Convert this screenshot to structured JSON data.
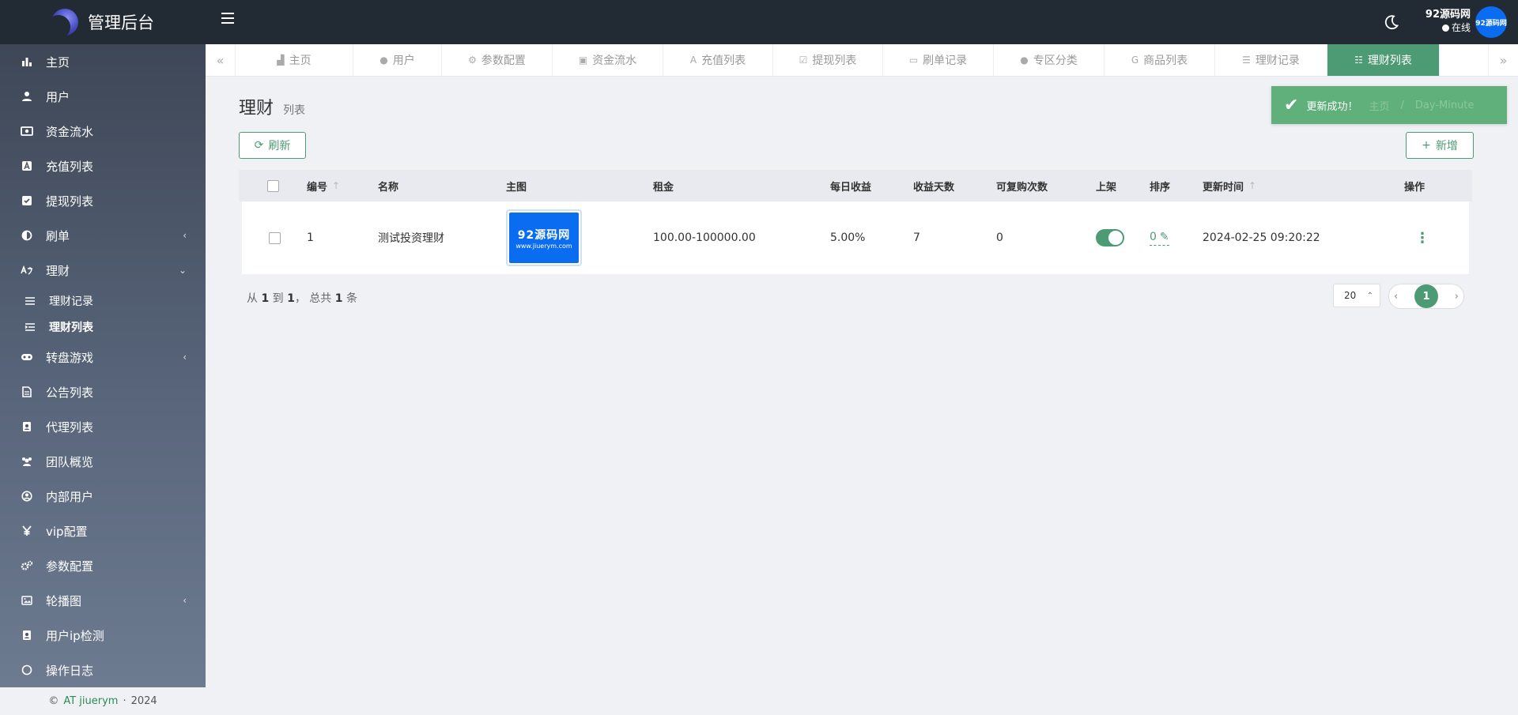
{
  "app": {
    "title": "管理后台"
  },
  "sidebar": {
    "items": [
      {
        "label": "主页",
        "icon": "bar-chart-icon"
      },
      {
        "label": "用户",
        "icon": "user-icon"
      },
      {
        "label": "资金流水",
        "icon": "money-icon"
      },
      {
        "label": "充值列表",
        "icon": "font-icon"
      },
      {
        "label": "提现列表",
        "icon": "check-square-icon"
      },
      {
        "label": "刷单",
        "icon": "adjust-icon",
        "expandable": true
      },
      {
        "label": "理财",
        "icon": "language-icon",
        "expanded": true
      },
      {
        "label": "理财记录",
        "icon": "list-icon",
        "sub": true
      },
      {
        "label": "理财列表",
        "icon": "indent-list-icon",
        "sub": true,
        "active": true
      },
      {
        "label": "转盘游戏",
        "icon": "gamepad-icon",
        "expandable": true
      },
      {
        "label": "公告列表",
        "icon": "file-icon"
      },
      {
        "label": "代理列表",
        "icon": "id-badge-icon"
      },
      {
        "label": "团队概览",
        "icon": "users-icon"
      },
      {
        "label": "内部用户",
        "icon": "user-circle-icon"
      },
      {
        "label": "vip配置",
        "icon": "yen-icon"
      },
      {
        "label": "参数配置",
        "icon": "cogs-icon"
      },
      {
        "label": "轮播图",
        "icon": "image-icon",
        "expandable": true
      },
      {
        "label": "用户ip检测",
        "icon": "id-card-icon"
      },
      {
        "label": "操作日志",
        "icon": "circle-icon"
      }
    ],
    "footer": {
      "copyright": "©",
      "link": "AT jiuerym",
      "sep": "·",
      "year": "2024"
    }
  },
  "topbar": {
    "user_name": "92源码网",
    "user_status": "在线",
    "avatar_text": "92源码网"
  },
  "tabs": [
    {
      "label": "主页",
      "icon": "▟"
    },
    {
      "label": "用户",
      "icon": "●"
    },
    {
      "label": "参数配置",
      "icon": "⚙"
    },
    {
      "label": "资金流水",
      "icon": "▣"
    },
    {
      "label": "充值列表",
      "icon": "A"
    },
    {
      "label": "提现列表",
      "icon": "☑"
    },
    {
      "label": "刷单记录",
      "icon": "▭"
    },
    {
      "label": "专区分类",
      "icon": "●"
    },
    {
      "label": "商品列表",
      "icon": "G"
    },
    {
      "label": "理财记录",
      "icon": "☰"
    },
    {
      "label": "理财列表",
      "icon": "☷",
      "active": true
    }
  ],
  "page": {
    "title": "理财",
    "subtitle": "列表"
  },
  "toolbar": {
    "refresh_label": "刷新",
    "add_label": "新增"
  },
  "toast": {
    "message": "更新成功！",
    "ghost_home": "主页",
    "ghost_sep": "/",
    "ghost_page": "Day-Minute"
  },
  "table": {
    "headers": {
      "id": "编号",
      "name": "名称",
      "image": "主图",
      "amount": "租金",
      "daily": "每日收益",
      "days": "收益天数",
      "repeat": "可复购次数",
      "listed": "上架",
      "sort": "排序",
      "updated": "更新时间",
      "ops": "操作"
    },
    "rows": [
      {
        "id": "1",
        "name": "测试投资理财",
        "image_text": "92源码网",
        "image_url_text": "www.jiuerym.com",
        "amount": "100.00-100000.00",
        "daily": "5.00%",
        "days": "7",
        "repeat": "0",
        "listed": true,
        "sort": "0",
        "updated": "2024-02-25 09:20:22"
      }
    ]
  },
  "pagination": {
    "from_label": "从",
    "from": "1",
    "to_label": "到",
    "to": "1",
    "total_label": "， 总共",
    "total": "1",
    "unit": "条",
    "page_size": "20",
    "current_page": "1"
  },
  "colors": {
    "accent": "#4d9b74",
    "topbar": "#222a33",
    "toast": "#5fb07b"
  }
}
